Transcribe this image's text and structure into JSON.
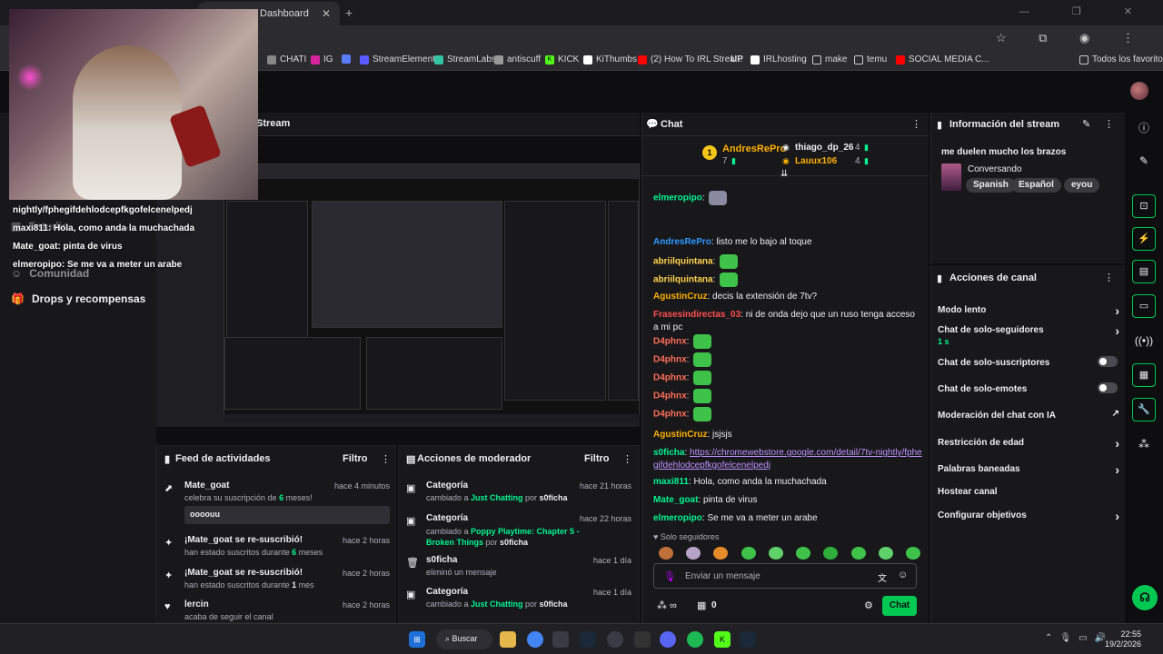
{
  "browser": {
    "tab_title": "Dashboard",
    "bookmarks": [
      "CHATI",
      "IG",
      "",
      "StreamElements",
      "StreamLabs",
      "antiscuff",
      "KICK",
      "KiThumbs",
      "(2) How To IRL Strea...",
      "UP",
      "IRLhosting",
      "make",
      "temu",
      "SOCIAL MEDIA C...",
      "Todos los favoritos"
    ]
  },
  "overlay_chat": [
    "nightly/fphegifdehlodcepfkgofelcenelpedj",
    "maxi811: Hola, como anda la muchachada",
    "Mate_goat: pinta de virus",
    "elmeropipo: Se me va a meter un arabe"
  ],
  "sidebar": {
    "items": [
      {
        "label": "Estudio"
      },
      {
        "label": "Comunidad"
      },
      {
        "label": "Drops y recompensas"
      }
    ]
  },
  "stream": {
    "title": "Stream"
  },
  "feed": {
    "title": "Feed de actividades",
    "filter": "Filtro",
    "items": [
      {
        "name": "Mate_goat",
        "time": "hace 4 minutos",
        "sub_a": "celebra su suscripción de ",
        "sub_b": "6",
        "sub_c": " meses!",
        "message": "oooouu"
      },
      {
        "name": "¡Mate_goat se re-suscribió!",
        "time": "hace 2 horas",
        "sub_a": "han estado suscritos durante ",
        "sub_b": "6",
        "sub_c": " meses"
      },
      {
        "name": "¡Mate_goat se re-suscribió!",
        "time": "hace 2 horas",
        "sub_a": "han estado suscritos durante ",
        "sub_b": "1",
        "sub_c": " mes"
      },
      {
        "name": "lercin",
        "time": "hace 2 horas",
        "sub_a": "acaba de seguir el canal",
        "sub_b": "",
        "sub_c": ""
      }
    ]
  },
  "mod": {
    "title": "Acciones de moderador",
    "filter": "Filtro",
    "items": [
      {
        "name": "Categoría",
        "time": "hace 21 horas",
        "a": "cambiado a ",
        "cat": "Just Chatting",
        "b": " por ",
        "user": "s0ficha"
      },
      {
        "name": "Categoría",
        "time": "hace 22 horas",
        "a": "cambiado a ",
        "cat": "Poppy Playtime: Chapter 5 - Broken Things",
        "b": " por ",
        "user": "s0ficha"
      },
      {
        "name": "s0ficha",
        "time": "hace 1 día",
        "a": "eliminó un mensaje",
        "cat": "",
        "b": "",
        "user": ""
      },
      {
        "name": "Categoría",
        "time": "hace 1 día",
        "a": "cambiado a ",
        "cat": "Just Chatting",
        "b": " por ",
        "user": "s0ficha"
      }
    ]
  },
  "chat": {
    "title": "Chat",
    "leaders": {
      "first": {
        "name": "AndresRePro",
        "count": "7"
      },
      "second": {
        "name": "thiago_dp_26",
        "count": "4"
      },
      "third": {
        "name": "Lauux106",
        "count": "4"
      }
    },
    "messages": [
      {
        "user": "elmeropipo",
        "color": "#00f593",
        "text": ""
      },
      {
        "user": "AndresRePro",
        "color": "#2e9bff",
        "text": "listo me lo bajo al toque"
      },
      {
        "user": "abriilquintana",
        "color": "#ffd34d",
        "text": ""
      },
      {
        "user": "abriilquintana",
        "color": "#ffd34d",
        "text": ""
      },
      {
        "user": "AgustinCruz",
        "color": "#ffb100",
        "text": "decis la extensión de 7tv?"
      },
      {
        "user": "Frasesindirectas_03",
        "color": "#ff4f4f",
        "text": "ni de onda dejo que un ruso tenga acceso a mi pc"
      },
      {
        "user": "D4phnx",
        "color": "#ff6f5a",
        "text": ""
      },
      {
        "user": "D4phnx",
        "color": "#ff6f5a",
        "text": ""
      },
      {
        "user": "D4phnx",
        "color": "#ff6f5a",
        "text": ""
      },
      {
        "user": "D4phnx",
        "color": "#ff6f5a",
        "text": ""
      },
      {
        "user": "D4phnx",
        "color": "#ff6f5a",
        "text": ""
      },
      {
        "user": "AgustinCruz",
        "color": "#ffb100",
        "text": "jsjsjs"
      },
      {
        "user": "s0ficha",
        "color": "#00f593",
        "text": "",
        "link": "https://chromewebstore.google.com/detail/7tv-nightly/fphegifdehlodcepfkgofelcenelpedj"
      },
      {
        "user": "maxi811",
        "color": "#00f593",
        "text": "Hola, como anda la muchachada"
      },
      {
        "user": "Mate_goat",
        "color": "#00f593",
        "text": "pinta de virus"
      },
      {
        "user": "elmeropipo",
        "color": "#00f593",
        "text": "Se me va a meter un arabe"
      }
    ],
    "mode_label": "Solo seguidores",
    "placeholder": "Enviar un mensaje",
    "points": "0",
    "send_label": "Chat"
  },
  "info": {
    "title": "Información del stream",
    "stream_title": "me duelen mucho los brazos",
    "category": "Conversando",
    "tags": [
      "Spanish",
      "Español",
      "eyou"
    ]
  },
  "actions": {
    "title": "Acciones de canal",
    "items": [
      {
        "label": "Modo lento",
        "kind": "chevron",
        "sub": ""
      },
      {
        "label": "Chat de solo-seguidores",
        "kind": "chevron",
        "sub": "1 s"
      },
      {
        "label": "Chat de solo-suscriptores",
        "kind": "toggle",
        "sub": ""
      },
      {
        "label": "Chat de solo-emotes",
        "kind": "toggle",
        "sub": ""
      },
      {
        "label": "Moderación del chat con IA",
        "kind": "external",
        "sub": ""
      },
      {
        "label": "Restricción de edad",
        "kind": "chevron",
        "sub": ""
      },
      {
        "label": "Palabras baneadas",
        "kind": "chevron",
        "sub": ""
      },
      {
        "label": "Hostear canal",
        "kind": "none",
        "sub": ""
      },
      {
        "label": "Configurar objetivos",
        "kind": "chevron",
        "sub": ""
      }
    ]
  },
  "taskbar": {
    "search_label": "Buscar",
    "time": "22:55",
    "date": "19/2/2026"
  }
}
